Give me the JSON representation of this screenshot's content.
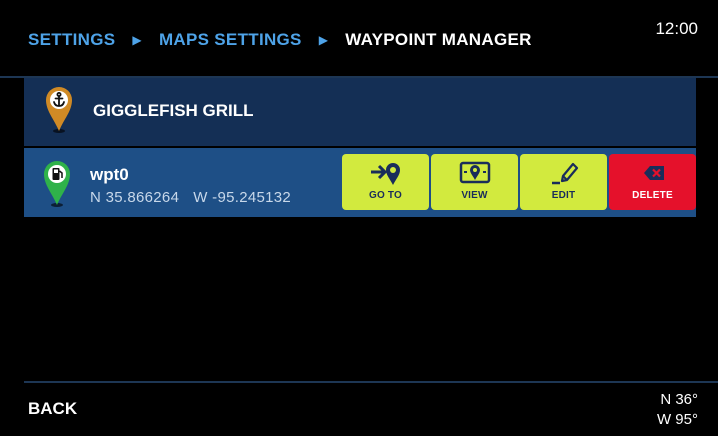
{
  "header": {
    "breadcrumb": [
      "SETTINGS",
      "MAPS SETTINGS",
      "WAYPOINT MANAGER"
    ],
    "clock": "12:00"
  },
  "waypoints": [
    {
      "name": "GIGGLEFISH GRILL",
      "icon": "anchor-pin-icon",
      "pin_color": "#d08a25"
    },
    {
      "name": "wpt0",
      "icon": "fuel-pin-icon",
      "pin_color": "#2fb24a",
      "lat": "N 35.866264",
      "lon": "W -95.245132",
      "selected": true
    }
  ],
  "actions": [
    {
      "label": "GO TO",
      "icon": "go-to-icon"
    },
    {
      "label": "VIEW",
      "icon": "view-icon"
    },
    {
      "label": "EDIT",
      "icon": "edit-icon"
    },
    {
      "label": "DELETE",
      "icon": "delete-icon"
    }
  ],
  "footer": {
    "back_label": "BACK",
    "position_lat": "N 36°",
    "position_lon": "W 95°"
  },
  "colors": {
    "accent_blue": "#4ea3e8",
    "row_dark": "#142f55",
    "row_selected": "#1e4f86",
    "action_green": "#d2ea3e",
    "delete_red": "#e5112b"
  }
}
